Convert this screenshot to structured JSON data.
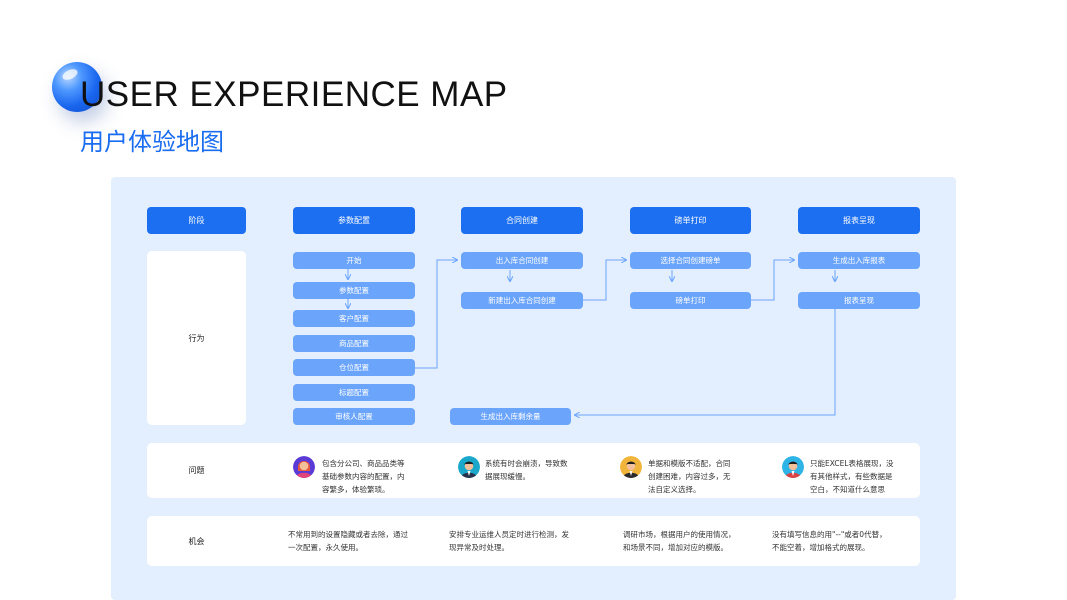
{
  "header": {
    "title_en": "USER EXPERIENCE MAP",
    "title_cn": "用户体验地图"
  },
  "colors": {
    "primary": "#1c6ff0",
    "pill": "#6ba4fb",
    "panel": "#e3eefe",
    "title_cn": "#1a6cf0"
  },
  "stages": {
    "label": "阶段",
    "items": [
      "参数配置",
      "合同创建",
      "磅单打印",
      "报表呈现"
    ]
  },
  "rows": {
    "behavior": "行为",
    "problem": "问题",
    "opportunity": "机会"
  },
  "behaviors": {
    "col1": [
      "开始",
      "参数配置",
      "客户配置",
      "商品配置",
      "仓位配置",
      "标题配置",
      "审核人配置"
    ],
    "col2": [
      "出入库合同创建",
      "新建出入库合同创建"
    ],
    "col3": [
      "选择合同创建磅单",
      "磅单打印"
    ],
    "col4": [
      "生成出入库报表",
      "报表呈现"
    ],
    "final": "生成出入库剩余量"
  },
  "problems": [
    {
      "avatar": "woman-avatar-icon",
      "lines": [
        "包含分公司、商品品类等",
        "基础参数内容的配置，内",
        "容繁多，体验繁琐。"
      ]
    },
    {
      "avatar": "man-avatar-icon",
      "lines": [
        "系统有时会崩溃，导致数",
        "据展现缓慢。"
      ]
    },
    {
      "avatar": "man-avatar-icon",
      "lines": [
        "单据和模版不适配，合同",
        "创建困难，内容过多，无",
        "法自定义选择。"
      ]
    },
    {
      "avatar": "man-avatar-icon",
      "lines": [
        "只能EXCEL表格展现，没",
        "有其他样式，有些数据是",
        "空白，不知道什么意思"
      ]
    }
  ],
  "opportunities": [
    {
      "lines": [
        "不常用到的设置隐藏或者去除，通过",
        "一次配置，永久使用。"
      ]
    },
    {
      "lines": [
        "安排专业运维人员定时进行检测，发",
        "现异常及时处理。"
      ]
    },
    {
      "lines": [
        "调研市场，根据用户的使用情况，",
        "和场景不同，增加对应的模版。"
      ]
    },
    {
      "lines": [
        "没有填写信息的用\"--\"或者0代替，",
        "不能空着，增加格式的展现。"
      ]
    }
  ]
}
